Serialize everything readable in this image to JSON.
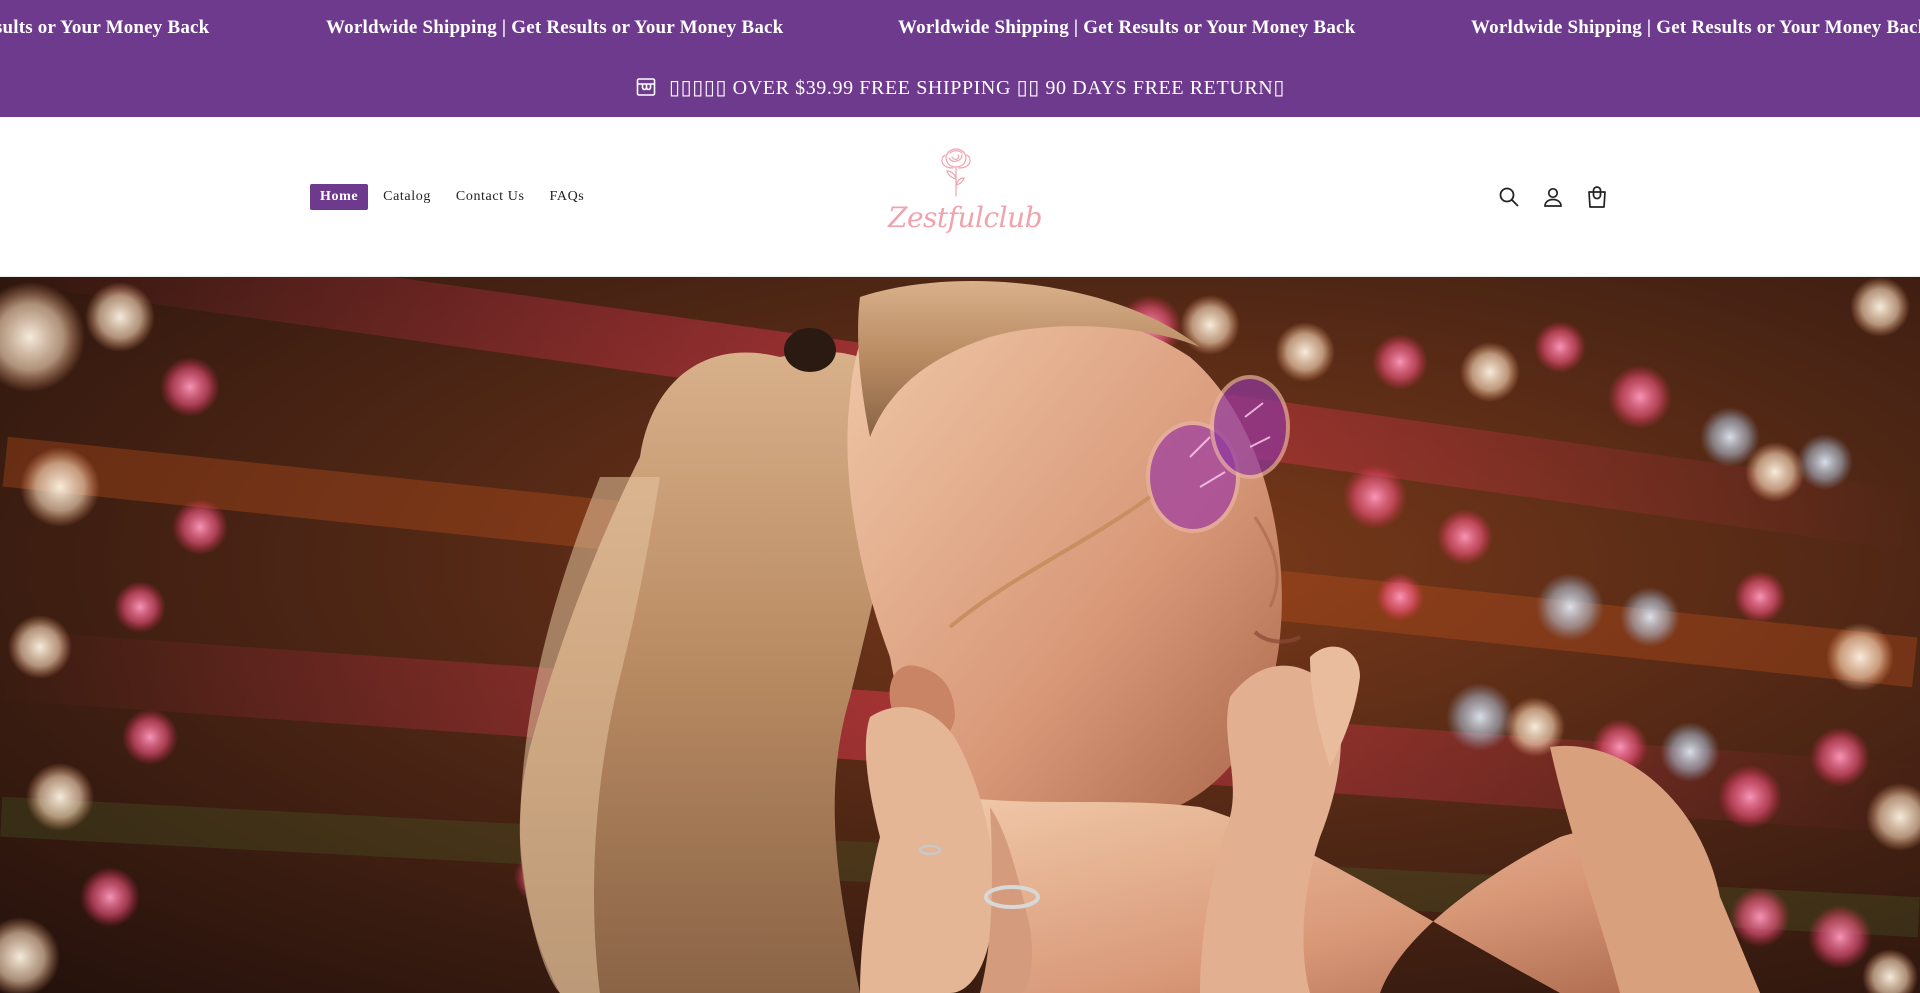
{
  "marquee": {
    "items": [
      "Worldwide Shipping | Get Results or Your Money Back",
      "Worldwide Shipping | Get Results or Your Money Back",
      "Worldwide Shipping | Get Results or Your Money Back",
      "Worldwide Shipping | Get Results or Your Money Back"
    ]
  },
  "announcement": {
    "icon": "shop-icon",
    "text": "▯▯▯▯▯ OVER $39.99 FREE SHIPPING ▯▯ 90 DAYS FREE RETURN▯"
  },
  "header": {
    "nav": [
      {
        "label": "Home",
        "active": true
      },
      {
        "label": "Catalog",
        "active": false
      },
      {
        "label": "Contact Us",
        "active": false
      },
      {
        "label": "FAQs",
        "active": false
      }
    ],
    "logo": {
      "text": "Zestfulclub",
      "icon": "rose-icon"
    },
    "icons": [
      "search-icon",
      "account-icon",
      "cart-icon"
    ]
  },
  "hero": {
    "image": "hero-photo"
  },
  "colors": {
    "brand": "#6e3a8e",
    "logo_pink": "#f0a3ad",
    "text": "#222222"
  }
}
